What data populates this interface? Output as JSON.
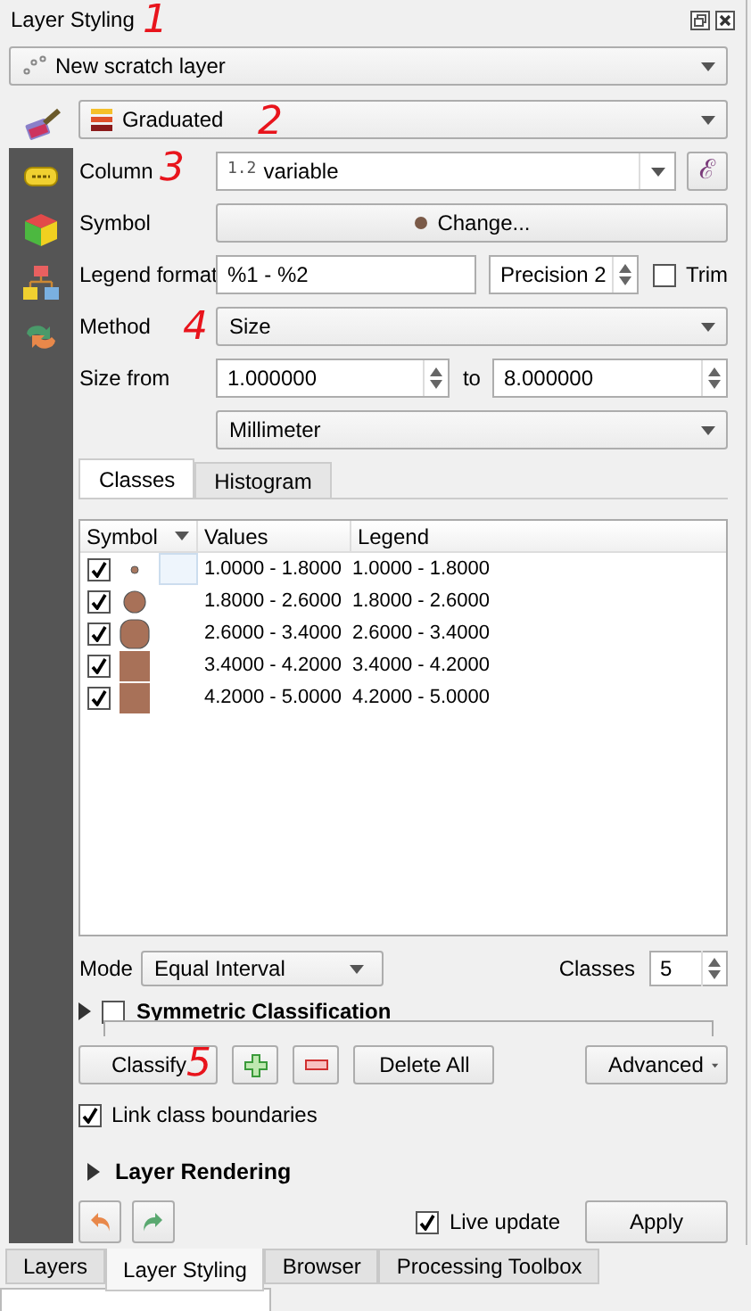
{
  "window": {
    "title": "Layer Styling",
    "annotation": "1"
  },
  "layer": {
    "value": "New scratch layer"
  },
  "sidebar": {
    "items": [
      {
        "kind": "style",
        "selected": true
      },
      {
        "kind": "labels",
        "selected": false
      },
      {
        "kind": "volume",
        "selected": false
      },
      {
        "kind": "diagrams",
        "selected": false
      },
      {
        "kind": "history",
        "selected": false
      }
    ]
  },
  "renderer": {
    "value": "Graduated",
    "annotation": "2"
  },
  "column": {
    "label": "Column",
    "type_prefix": "1.2",
    "value": "variable",
    "expression_button": "ℰ",
    "annotation": "3"
  },
  "symbol": {
    "label": "Symbol",
    "button": "Change..."
  },
  "legend_format": {
    "label": "Legend format",
    "value": "%1 - %2",
    "precision": "Precision 2",
    "trim": {
      "label": "Trim",
      "checked": false
    }
  },
  "method": {
    "label": "Method",
    "value": "Size",
    "annotation": "4"
  },
  "size": {
    "label": "Size from",
    "from": "1.000000",
    "to_label": "to",
    "to": "8.000000",
    "unit": "Millimeter"
  },
  "tabs": [
    {
      "label": "Classes",
      "selected": true
    },
    {
      "label": "Histogram",
      "selected": false
    }
  ],
  "table": {
    "columns": [
      "Symbol",
      "Values",
      "Legend"
    ],
    "rows": [
      {
        "checked": true,
        "kind": "small",
        "selected": true,
        "values": "1.0000 - 1.8000",
        "legend": "1.0000 - 1.8000"
      },
      {
        "checked": true,
        "kind": "medium",
        "selected": false,
        "values": "1.8000 - 2.6000",
        "legend": "1.8000 - 2.6000"
      },
      {
        "checked": true,
        "kind": "large",
        "selected": false,
        "values": "2.6000 - 3.4000",
        "legend": "2.6000 - 3.4000"
      },
      {
        "checked": true,
        "kind": "square",
        "selected": false,
        "values": "3.4000 - 4.2000",
        "legend": "3.4000 - 4.2000"
      },
      {
        "checked": true,
        "kind": "square",
        "selected": false,
        "values": "4.2000 - 5.0000",
        "legend": "4.2000 - 5.0000"
      }
    ]
  },
  "mode": {
    "label": "Mode",
    "value": "Equal Interval",
    "classes_label": "Classes",
    "classes": "5"
  },
  "symmetric": {
    "label": "Symmetric Classification",
    "checked": false,
    "expanded": false
  },
  "actions": {
    "classify": "Classify",
    "annotation": "5",
    "delete_all": "Delete All",
    "advanced": "Advanced"
  },
  "link_boundaries": {
    "label": "Link class boundaries",
    "checked": true
  },
  "layer_rendering": {
    "label": "Layer Rendering",
    "expanded": false
  },
  "live_update": {
    "label": "Live update",
    "checked": true
  },
  "apply": "Apply",
  "bottom_tabs": [
    {
      "label": "Layers",
      "selected": false
    },
    {
      "label": "Layer Styling",
      "selected": true
    },
    {
      "label": "Browser",
      "selected": false
    },
    {
      "label": "Processing Toolbox",
      "selected": false
    }
  ]
}
